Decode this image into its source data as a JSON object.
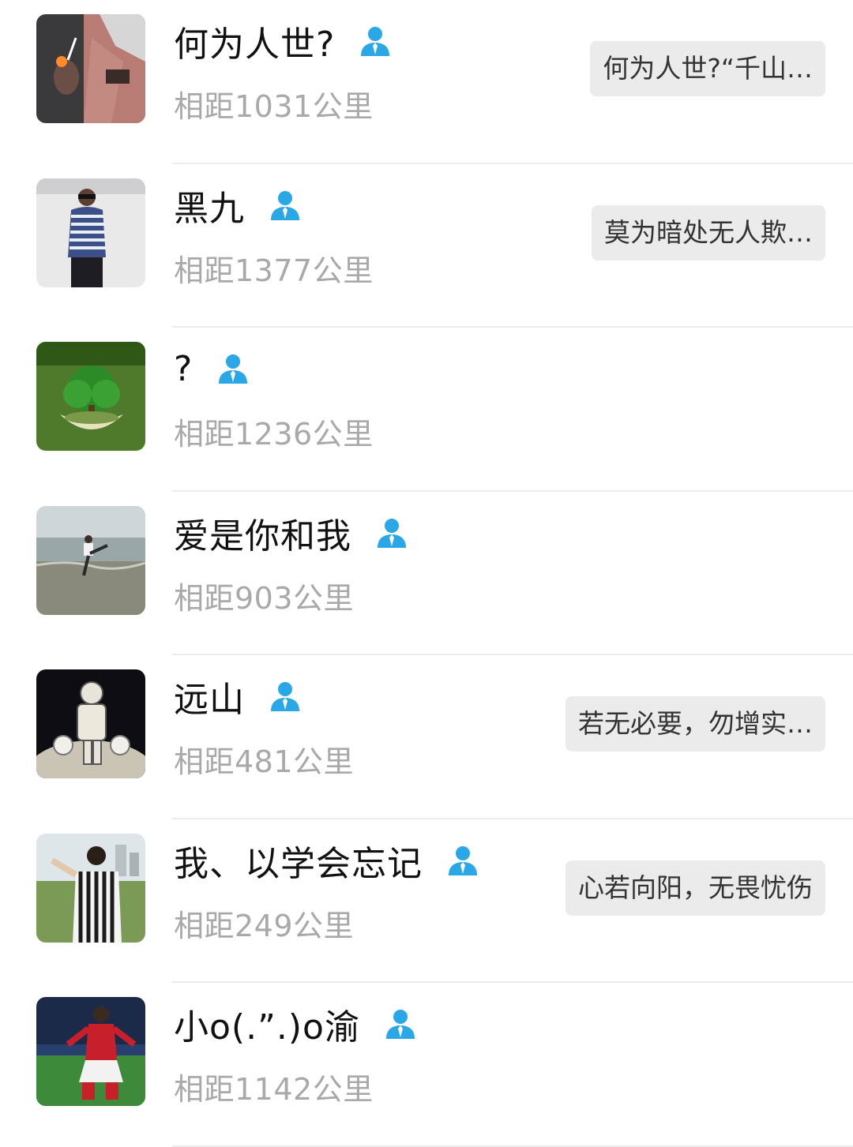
{
  "colors": {
    "accent_icon": "#2aa7e6",
    "name_text": "#111111",
    "distance_text": "#a9a9a9",
    "bubble_bg": "#ebebeb",
    "divider": "#ececec"
  },
  "icons": {
    "user_badge": "person-icon"
  },
  "contacts": [
    {
      "name": "何为人世?",
      "distance": "相距1031公里",
      "signature": "何为人世?“千山…"
    },
    {
      "name": "黑九",
      "distance": "相距1377公里",
      "signature": "莫为暗处无人欺…"
    },
    {
      "name": "?",
      "distance": "相距1236公里",
      "signature": ""
    },
    {
      "name": "爱是你和我",
      "distance": "相距903公里",
      "signature": ""
    },
    {
      "name": "远山",
      "distance": "相距481公里",
      "signature": "若无必要，勿增实…"
    },
    {
      "name": "我、以学会忘记",
      "distance": "相距249公里",
      "signature": "心若向阳，无畏忧伤"
    },
    {
      "name": "小o(.”.)o渝",
      "distance": "相距1142公里",
      "signature": ""
    }
  ]
}
